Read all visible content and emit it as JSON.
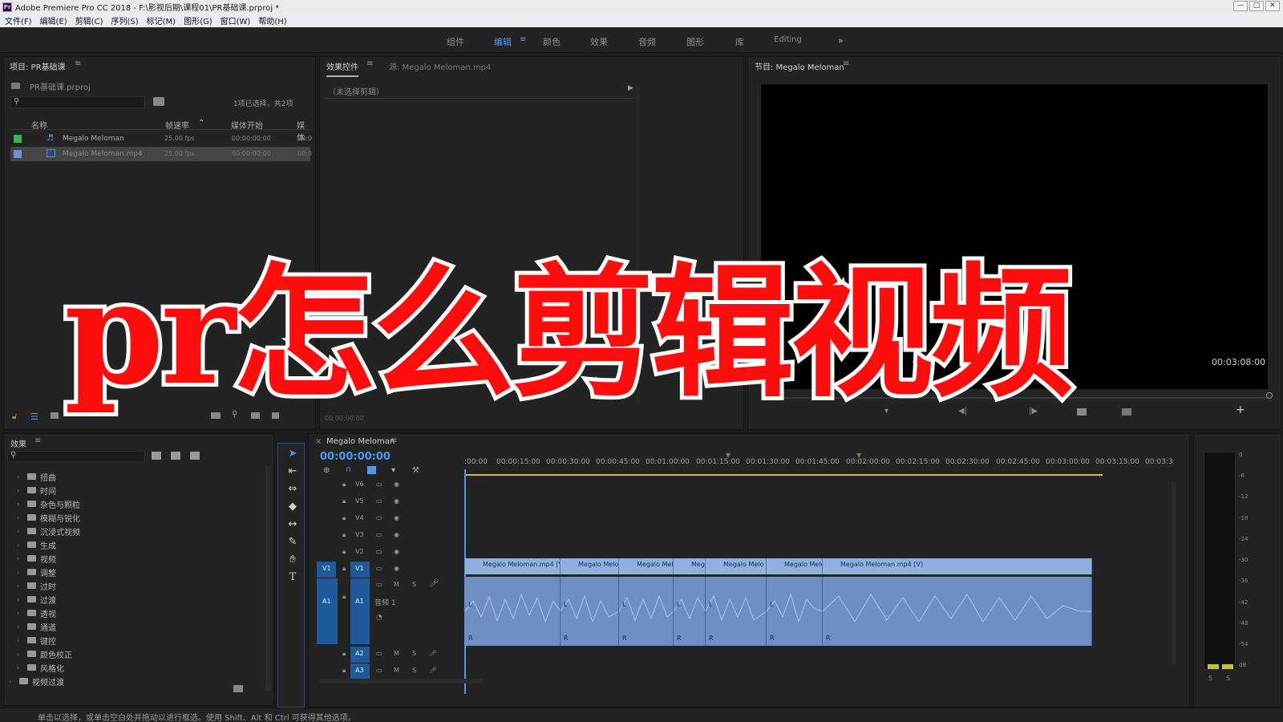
{
  "window": {
    "title": "Adobe Premiere Pro CC 2018 - F:\\影视后期\\课程01\\PR基础课.prproj *",
    "controls": [
      "—",
      "▢",
      "✕"
    ]
  },
  "menu": [
    "文件(F)",
    "编辑(E)",
    "剪辑(C)",
    "序列(S)",
    "标记(M)",
    "图形(G)",
    "窗口(W)",
    "帮助(H)"
  ],
  "workspaces": {
    "items": [
      "组件",
      "编辑",
      "颜色",
      "效果",
      "音频",
      "图形",
      "库",
      "Editing"
    ],
    "active": "编辑",
    "more": "»"
  },
  "project": {
    "title": "项目: PR基础课",
    "file": "PR基础课.prproj",
    "selection_info": "1项已选择，共2项",
    "columns": [
      "名称",
      "帧速率",
      "媒体开始",
      "媒体"
    ],
    "rows": [
      {
        "name": "Megalo Meloman",
        "fps": "25.00 fps",
        "start": "00:00:00:00",
        "extra": "00:0",
        "color": "#3fb34f"
      },
      {
        "name": "Megalo Meloman.mp4",
        "fps": "25.00 fps",
        "start": "00:00:00:00",
        "extra": "00:0",
        "color": "#6f8fd8"
      }
    ]
  },
  "effect_controls": {
    "tab1": "效果控件",
    "tab2": "源: Megalo Meloman.mp4",
    "no_clip": "（未选择剪辑）",
    "timecode": "00:00:00:00"
  },
  "program": {
    "title": "节目: Megalo Meloman",
    "duration": "00:03:08:00"
  },
  "effects": {
    "title": "效果",
    "items": [
      "扭曲",
      "时间",
      "杂色与颗粒",
      "模糊与锐化",
      "沉浸式视频",
      "生成",
      "视频",
      "调整",
      "过时",
      "过渡",
      "透视",
      "通道",
      "键控",
      "颜色校正",
      "风格化"
    ],
    "bottom_item": "视频过渡"
  },
  "timeline": {
    "sequence_name": "Megalo Meloman",
    "timecode": "00:00:00:00",
    "ruler": [
      ":00:00",
      "00:00:15:00",
      "00:00:30:00",
      "00:00:45:00",
      "00:01:00:00",
      "00:01:15:00",
      "00:01:30:00",
      "00:01:45:00",
      "00:02:00:00",
      "00:02:15:00",
      "00:02:30:00",
      "00:02:45:00",
      "00:03:00:00",
      "00:03:15:00",
      "00:03:3"
    ],
    "video_tracks": [
      "V6",
      "V5",
      "V4",
      "V3",
      "V2",
      "V1"
    ],
    "audio_tracks": [
      "A1",
      "A2",
      "A3"
    ],
    "audio_label": "音频 1",
    "clips": [
      "Megalo Meloman.mp4 [V]",
      "Megalo Melom",
      "Megalo Melo",
      "Meg",
      "Megalo Melo",
      "Megalo Melo",
      "Megalo Meloman.mp4 [V]"
    ],
    "channel_left": "L",
    "channel_right": "R"
  },
  "meter": {
    "scale": [
      "0",
      "-6",
      "-12",
      "-18",
      "-24",
      "-30",
      "-36",
      "-42",
      "-48",
      "-54",
      "dB"
    ],
    "solo": [
      "S",
      "S"
    ]
  },
  "status": "单击以选择，或单击空白处并拖动以进行框选。使用 Shift、Alt 和 Ctrl 可获得其他选项。",
  "overlay": "pr怎么剪辑视频"
}
